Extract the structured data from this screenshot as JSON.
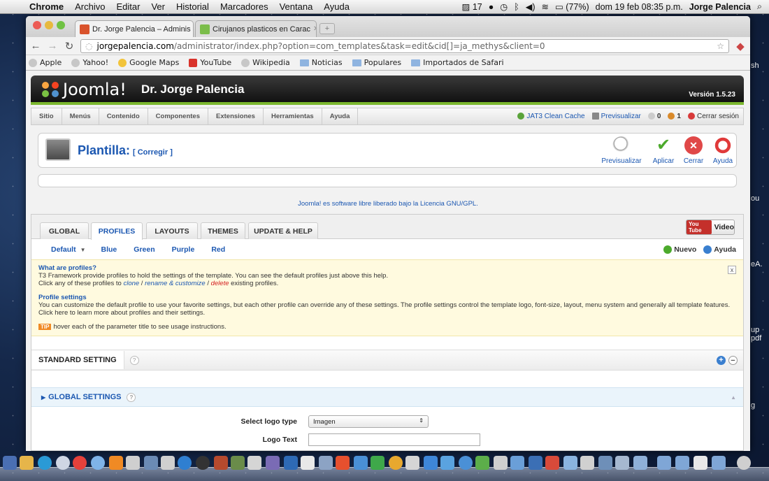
{
  "menubar": {
    "app": "Chrome",
    "items": [
      "Archivo",
      "Editar",
      "Ver",
      "Historial",
      "Marcadores",
      "Ventana",
      "Ayuda"
    ],
    "status": {
      "icon_count": "17",
      "battery": "(77%)",
      "datetime": "dom 19 feb 08:35 p.m.",
      "user": "Jorge Palencia"
    }
  },
  "browser": {
    "tabs": [
      {
        "title": "Dr. Jorge Palencia – Adminis",
        "active": true
      },
      {
        "title": "Cirujanos plasticos en Carac",
        "active": false
      }
    ],
    "url_host": "jorgepalencia.com",
    "url_path": "/administrator/index.php?option=com_templates&task=edit&cid[]=ja_methys&client=0",
    "bookmarks": [
      "Apple",
      "Yahoo!",
      "Google Maps",
      "YouTube",
      "Wikipedia",
      "Noticias",
      "Populares",
      "Importados de Safari"
    ]
  },
  "joomla": {
    "logo_text": "Joomla!",
    "site_name": "Dr. Jorge Palencia",
    "version": "Versión 1.5.23",
    "menu": [
      "Sitio",
      "Menús",
      "Contenido",
      "Componentes",
      "Extensiones",
      "Herramientas",
      "Ayuda"
    ],
    "status": {
      "cache": "JAT3 Clean Cache",
      "preview": "Previsualizar",
      "messages": "0",
      "users": "1",
      "logout": "Cerrar sesión"
    },
    "page_title": "Plantilla:",
    "page_subtitle": "[ Corregir ]",
    "toolbar": {
      "preview": "Previsualizar",
      "apply": "Aplicar",
      "close": "Cerrar",
      "help": "Ayuda"
    },
    "gpl_prefix": "Joomla! es software libre liberado bajo la ",
    "gpl_link": "Licencia GNU/GPL",
    "gpl_suffix": "."
  },
  "t3": {
    "tabs": [
      "GLOBAL",
      "PROFILES",
      "LAYOUTS",
      "THEMES",
      "UPDATE & HELP"
    ],
    "active_tab": "PROFILES",
    "video": "Video",
    "yt": "You Tube",
    "profiles": [
      "Default",
      "Blue",
      "Green",
      "Purple",
      "Red"
    ],
    "new_label": "Nuevo",
    "help_label": "Ayuda",
    "help": {
      "h1": "What are profiles?",
      "l1": "T3 Framework provide profiles to hold the settings of the template. You can see the default profiles just above this help.",
      "l2a": "Click any of these profiles to ",
      "clone": "clone",
      "sep1": " / ",
      "rename": "rename & customize",
      "sep2": " / ",
      "delete": "delete",
      "l2b": " existing profiles.",
      "h2": "Profile settings",
      "l3": "You can customize the default profile to use your favorite settings, but each other profile can override any of these settings. The profile settings control the template logo, font-size, layout, menu system and generally all template features.",
      "l4": "Click here to learn more about profiles and their settings.",
      "tip": "TIP",
      "tip_text": "hover each of the parameter title to see usage instructions."
    },
    "standard_setting": "STANDARD SETTING",
    "global_settings": "GLOBAL SETTINGS",
    "fields": {
      "logo_type_label": "Select logo type",
      "logo_type_value": "Imagen",
      "logo_text_label": "Logo Text",
      "logo_text_value": ""
    }
  },
  "desktop_labels": [
    "sh",
    "ou",
    "eA.",
    "up",
    "pdf",
    "g"
  ]
}
